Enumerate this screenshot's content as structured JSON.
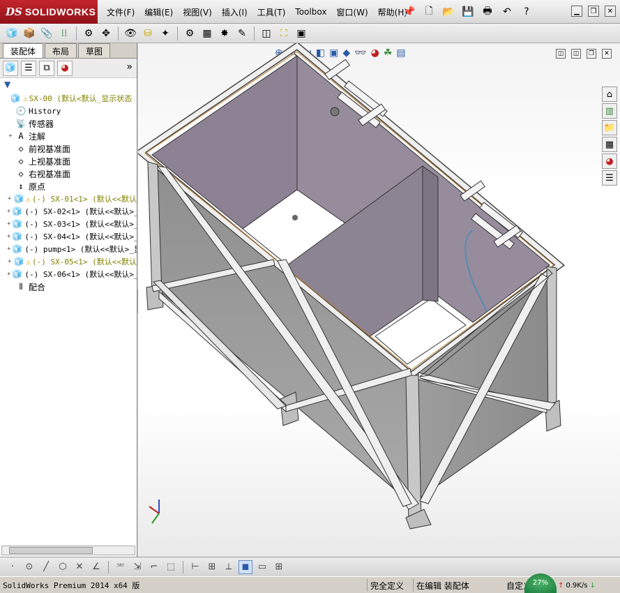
{
  "app": {
    "logo_ds": "DS",
    "logo_name": "SOLIDWORKS",
    "menu": [
      "文件(F)",
      "编辑(E)",
      "视图(V)",
      "插入(I)",
      "工具(T)",
      "Toolbox",
      "窗口(W)",
      "帮助(H)"
    ]
  },
  "icons": {
    "title_tools": [
      "pin-icon",
      "new-document-icon",
      "open-folder-icon",
      "save-icon",
      "print-icon",
      "undo-icon",
      "help-icon"
    ],
    "colors": {
      "brand_red": "#b01c22",
      "selection_blue": "#2a5aa8",
      "warning_yellow": "#d9a000",
      "component_olive": "#808000"
    }
  },
  "panel": {
    "tabs": [
      "装配体",
      "布局",
      "草图"
    ],
    "more": "»",
    "tree": [
      {
        "label": "SX-00  (默认<默认_显示状态",
        "kind": "assembly",
        "warn": true,
        "expander": ""
      },
      {
        "label": "History",
        "kind": "history",
        "warn": false,
        "expander": ""
      },
      {
        "label": "传感器",
        "kind": "sensor",
        "warn": false,
        "expander": ""
      },
      {
        "label": "注解",
        "kind": "annotation",
        "warn": false,
        "expander": "+"
      },
      {
        "label": "前视基准面",
        "kind": "plane",
        "warn": false,
        "expander": ""
      },
      {
        "label": "上视基准面",
        "kind": "plane",
        "warn": false,
        "expander": ""
      },
      {
        "label": "右视基准面",
        "kind": "plane",
        "warn": false,
        "expander": ""
      },
      {
        "label": "原点",
        "kind": "origin",
        "warn": false,
        "expander": ""
      },
      {
        "label": "(-) SX-01<1> (默认<<默认",
        "kind": "component",
        "warn": true,
        "expander": "+"
      },
      {
        "label": "(-) SX-02<1> (默认<<默认>_",
        "kind": "component",
        "warn": false,
        "expander": "+"
      },
      {
        "label": "(-) SX-03<1> (默认<<默认>_",
        "kind": "component",
        "warn": false,
        "expander": "+"
      },
      {
        "label": "(-) SX-04<1> (默认<<默认>_",
        "kind": "component",
        "warn": false,
        "expander": "+"
      },
      {
        "label": "(-) pump<1> (默认<<默认>_显",
        "kind": "component",
        "warn": false,
        "expander": "+"
      },
      {
        "label": "(-) SX-05<1> (默认<<默认",
        "kind": "component",
        "warn": true,
        "expander": "+"
      },
      {
        "label": "(-) SX-06<1> (默认<<默认>_",
        "kind": "component",
        "warn": false,
        "expander": "+"
      },
      {
        "label": "配合",
        "kind": "mates",
        "warn": false,
        "expander": ""
      }
    ]
  },
  "status": {
    "product": "SolidWorks Premium 2014 x64 版",
    "defined": "完全定义",
    "editing": "在编辑 装配体",
    "custom": "自定义",
    "net_percent": "27%",
    "net_speed": "0.9K/s"
  }
}
